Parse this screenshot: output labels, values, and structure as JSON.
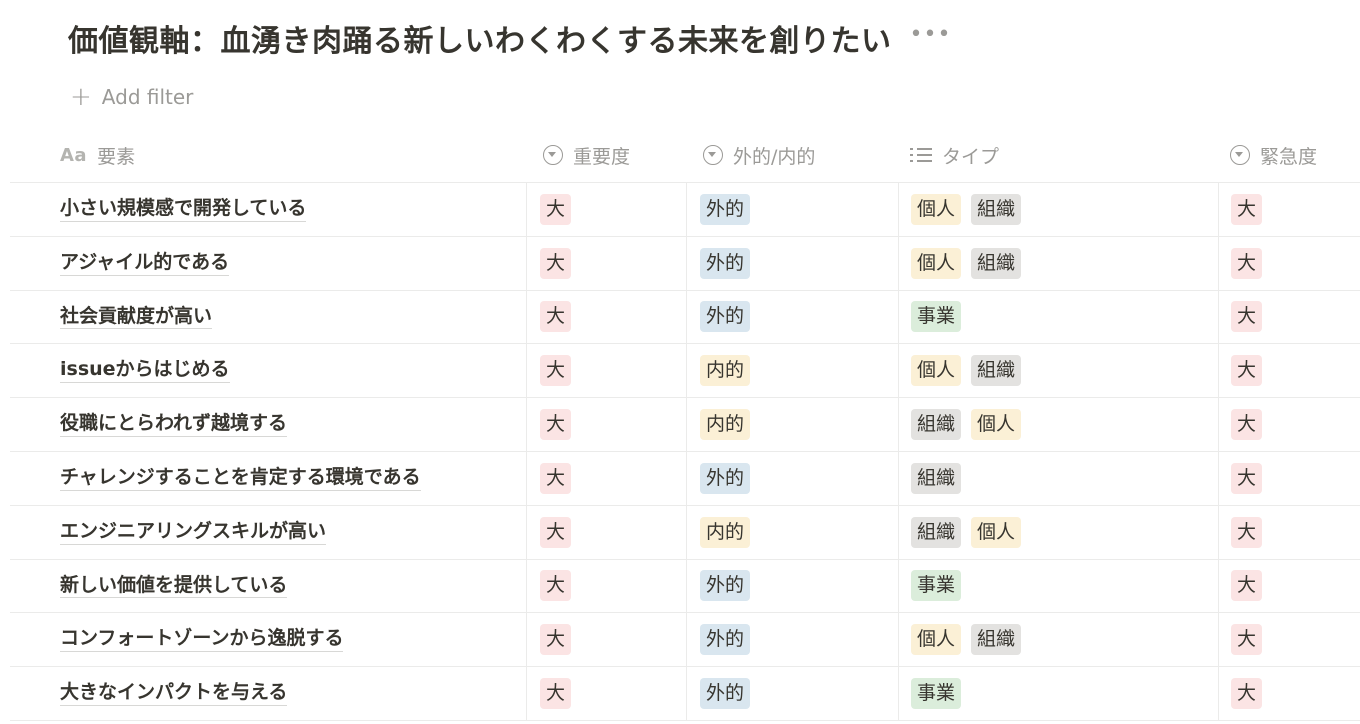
{
  "page": {
    "title": "価値観軸：血湧き肉踊る新しいわくわくする未来を創りたい",
    "more": "•••",
    "add_filter": "Add filter"
  },
  "columns": {
    "name": "要素",
    "name_icon": "Aa",
    "importance": "重要度",
    "external": "外的/内的",
    "type": "タイプ",
    "urgency": "緊急度"
  },
  "colors": {
    "大": "red",
    "外的": "blue",
    "内的": "yellow",
    "個人": "yellow",
    "組織": "gray",
    "事業": "green"
  },
  "rows": [
    {
      "name": "小さい規模感で開発している",
      "importance": "大",
      "external": "外的",
      "types": [
        "個人",
        "組織"
      ],
      "urgency": "大"
    },
    {
      "name": "アジャイル的である",
      "importance": "大",
      "external": "外的",
      "types": [
        "個人",
        "組織"
      ],
      "urgency": "大"
    },
    {
      "name": "社会貢献度が高い",
      "importance": "大",
      "external": "外的",
      "types": [
        "事業"
      ],
      "urgency": "大"
    },
    {
      "name": "issueからはじめる",
      "importance": "大",
      "external": "内的",
      "types": [
        "個人",
        "組織"
      ],
      "urgency": "大"
    },
    {
      "name": "役職にとらわれず越境する",
      "importance": "大",
      "external": "内的",
      "types": [
        "組織",
        "個人"
      ],
      "urgency": "大"
    },
    {
      "name": "チャレンジすることを肯定する環境である",
      "importance": "大",
      "external": "外的",
      "types": [
        "組織"
      ],
      "urgency": "大"
    },
    {
      "name": "エンジニアリングスキルが高い",
      "importance": "大",
      "external": "内的",
      "types": [
        "組織",
        "個人"
      ],
      "urgency": "大"
    },
    {
      "name": "新しい価値を提供している",
      "importance": "大",
      "external": "外的",
      "types": [
        "事業"
      ],
      "urgency": "大"
    },
    {
      "name": "コンフォートゾーンから逸脱する",
      "importance": "大",
      "external": "外的",
      "types": [
        "個人",
        "組織"
      ],
      "urgency": "大"
    },
    {
      "name": "大きなインパクトを与える",
      "importance": "大",
      "external": "外的",
      "types": [
        "事業"
      ],
      "urgency": "大"
    }
  ]
}
